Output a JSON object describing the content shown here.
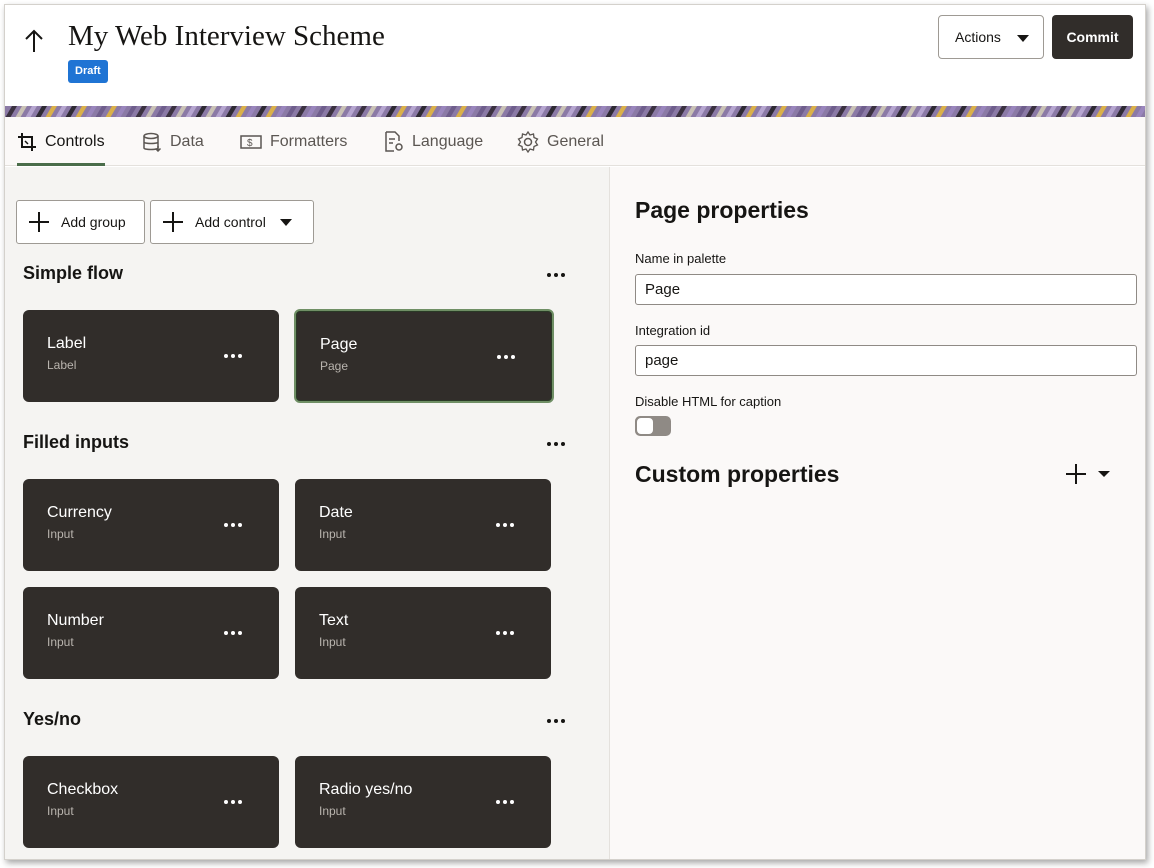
{
  "header": {
    "title": "My Web Interview Scheme",
    "status_badge": "Draft",
    "actions_label": "Actions",
    "commit_label": "Commit"
  },
  "tabs": [
    {
      "label": "Controls",
      "icon": "crop-icon",
      "active": true
    },
    {
      "label": "Data",
      "icon": "database-icon",
      "active": false
    },
    {
      "label": "Formatters",
      "icon": "formatter-icon",
      "active": false
    },
    {
      "label": "Language",
      "icon": "document-settings-icon",
      "active": false
    },
    {
      "label": "General",
      "icon": "gear-icon",
      "active": false
    }
  ],
  "toolbar": {
    "add_group_label": "Add group",
    "add_control_label": "Add control"
  },
  "groups": [
    {
      "title": "Simple flow",
      "cards": [
        {
          "title": "Label",
          "subtitle": "Label"
        },
        {
          "title": "Page",
          "subtitle": "Page",
          "selected": true
        }
      ]
    },
    {
      "title": "Filled inputs",
      "cards": [
        {
          "title": "Currency",
          "subtitle": "Input"
        },
        {
          "title": "Date",
          "subtitle": "Input"
        },
        {
          "title": "Number",
          "subtitle": "Input"
        },
        {
          "title": "Text",
          "subtitle": "Input"
        }
      ]
    },
    {
      "title": "Yes/no",
      "cards": [
        {
          "title": "Checkbox",
          "subtitle": "Input"
        },
        {
          "title": "Radio yes/no",
          "subtitle": "Input"
        }
      ]
    }
  ],
  "properties": {
    "title": "Page properties",
    "name_label": "Name in palette",
    "name_value": "Page",
    "integration_label": "Integration id",
    "integration_value": "page",
    "disable_html_label": "Disable HTML for caption",
    "disable_html_on": false,
    "custom_title": "Custom properties"
  },
  "colors": {
    "card_bg": "#312d2a",
    "badge_bg": "#1f74d4",
    "tab_underline": "#4a6d4a",
    "commit_bg": "#312d2a"
  }
}
